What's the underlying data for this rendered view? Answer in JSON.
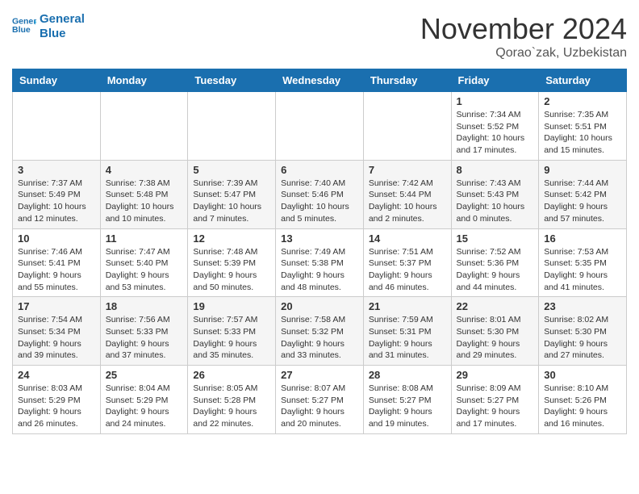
{
  "header": {
    "logo_line1": "General",
    "logo_line2": "Blue",
    "month_title": "November 2024",
    "location": "Qorao`zak, Uzbekistan"
  },
  "weekdays": [
    "Sunday",
    "Monday",
    "Tuesday",
    "Wednesday",
    "Thursday",
    "Friday",
    "Saturday"
  ],
  "weeks": [
    [
      {
        "day": "",
        "info": ""
      },
      {
        "day": "",
        "info": ""
      },
      {
        "day": "",
        "info": ""
      },
      {
        "day": "",
        "info": ""
      },
      {
        "day": "",
        "info": ""
      },
      {
        "day": "1",
        "info": "Sunrise: 7:34 AM\nSunset: 5:52 PM\nDaylight: 10 hours and 17 minutes."
      },
      {
        "day": "2",
        "info": "Sunrise: 7:35 AM\nSunset: 5:51 PM\nDaylight: 10 hours and 15 minutes."
      }
    ],
    [
      {
        "day": "3",
        "info": "Sunrise: 7:37 AM\nSunset: 5:49 PM\nDaylight: 10 hours and 12 minutes."
      },
      {
        "day": "4",
        "info": "Sunrise: 7:38 AM\nSunset: 5:48 PM\nDaylight: 10 hours and 10 minutes."
      },
      {
        "day": "5",
        "info": "Sunrise: 7:39 AM\nSunset: 5:47 PM\nDaylight: 10 hours and 7 minutes."
      },
      {
        "day": "6",
        "info": "Sunrise: 7:40 AM\nSunset: 5:46 PM\nDaylight: 10 hours and 5 minutes."
      },
      {
        "day": "7",
        "info": "Sunrise: 7:42 AM\nSunset: 5:44 PM\nDaylight: 10 hours and 2 minutes."
      },
      {
        "day": "8",
        "info": "Sunrise: 7:43 AM\nSunset: 5:43 PM\nDaylight: 10 hours and 0 minutes."
      },
      {
        "day": "9",
        "info": "Sunrise: 7:44 AM\nSunset: 5:42 PM\nDaylight: 9 hours and 57 minutes."
      }
    ],
    [
      {
        "day": "10",
        "info": "Sunrise: 7:46 AM\nSunset: 5:41 PM\nDaylight: 9 hours and 55 minutes."
      },
      {
        "day": "11",
        "info": "Sunrise: 7:47 AM\nSunset: 5:40 PM\nDaylight: 9 hours and 53 minutes."
      },
      {
        "day": "12",
        "info": "Sunrise: 7:48 AM\nSunset: 5:39 PM\nDaylight: 9 hours and 50 minutes."
      },
      {
        "day": "13",
        "info": "Sunrise: 7:49 AM\nSunset: 5:38 PM\nDaylight: 9 hours and 48 minutes."
      },
      {
        "day": "14",
        "info": "Sunrise: 7:51 AM\nSunset: 5:37 PM\nDaylight: 9 hours and 46 minutes."
      },
      {
        "day": "15",
        "info": "Sunrise: 7:52 AM\nSunset: 5:36 PM\nDaylight: 9 hours and 44 minutes."
      },
      {
        "day": "16",
        "info": "Sunrise: 7:53 AM\nSunset: 5:35 PM\nDaylight: 9 hours and 41 minutes."
      }
    ],
    [
      {
        "day": "17",
        "info": "Sunrise: 7:54 AM\nSunset: 5:34 PM\nDaylight: 9 hours and 39 minutes."
      },
      {
        "day": "18",
        "info": "Sunrise: 7:56 AM\nSunset: 5:33 PM\nDaylight: 9 hours and 37 minutes."
      },
      {
        "day": "19",
        "info": "Sunrise: 7:57 AM\nSunset: 5:33 PM\nDaylight: 9 hours and 35 minutes."
      },
      {
        "day": "20",
        "info": "Sunrise: 7:58 AM\nSunset: 5:32 PM\nDaylight: 9 hours and 33 minutes."
      },
      {
        "day": "21",
        "info": "Sunrise: 7:59 AM\nSunset: 5:31 PM\nDaylight: 9 hours and 31 minutes."
      },
      {
        "day": "22",
        "info": "Sunrise: 8:01 AM\nSunset: 5:30 PM\nDaylight: 9 hours and 29 minutes."
      },
      {
        "day": "23",
        "info": "Sunrise: 8:02 AM\nSunset: 5:30 PM\nDaylight: 9 hours and 27 minutes."
      }
    ],
    [
      {
        "day": "24",
        "info": "Sunrise: 8:03 AM\nSunset: 5:29 PM\nDaylight: 9 hours and 26 minutes."
      },
      {
        "day": "25",
        "info": "Sunrise: 8:04 AM\nSunset: 5:29 PM\nDaylight: 9 hours and 24 minutes."
      },
      {
        "day": "26",
        "info": "Sunrise: 8:05 AM\nSunset: 5:28 PM\nDaylight: 9 hours and 22 minutes."
      },
      {
        "day": "27",
        "info": "Sunrise: 8:07 AM\nSunset: 5:27 PM\nDaylight: 9 hours and 20 minutes."
      },
      {
        "day": "28",
        "info": "Sunrise: 8:08 AM\nSunset: 5:27 PM\nDaylight: 9 hours and 19 minutes."
      },
      {
        "day": "29",
        "info": "Sunrise: 8:09 AM\nSunset: 5:27 PM\nDaylight: 9 hours and 17 minutes."
      },
      {
        "day": "30",
        "info": "Sunrise: 8:10 AM\nSunset: 5:26 PM\nDaylight: 9 hours and 16 minutes."
      }
    ]
  ]
}
